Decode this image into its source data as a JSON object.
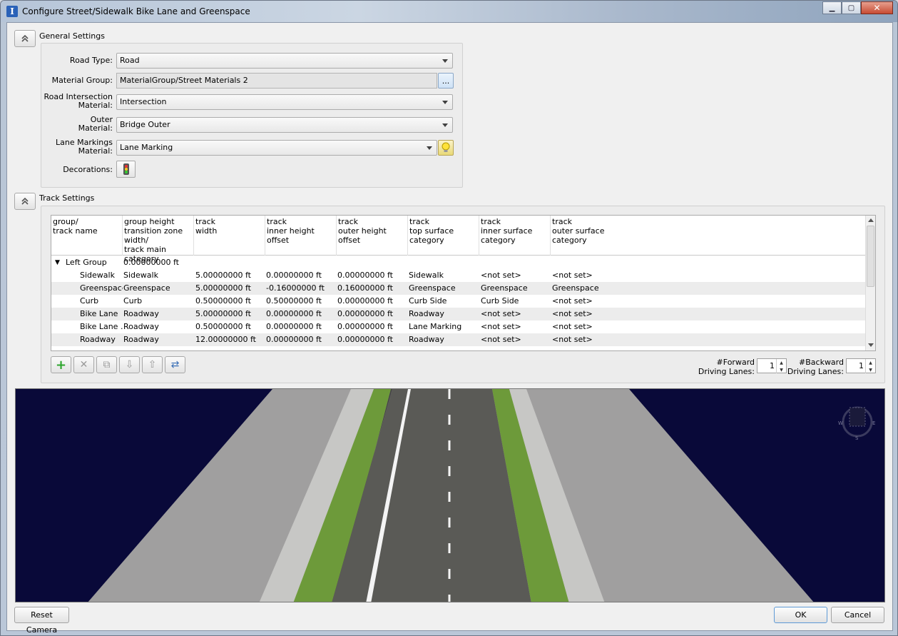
{
  "window": {
    "title": "Configure Street/Sidewalk Bike Lane and Greenspace",
    "minimize_glyph": "▁",
    "maximize_glyph": "▢",
    "close_glyph": "✕"
  },
  "general_settings": {
    "title": "General Settings",
    "road_type": {
      "label": "Road Type:",
      "value": "Road"
    },
    "material_group": {
      "label": "Material Group:",
      "value": "MaterialGroup/Street Materials 2",
      "browse_label": "..."
    },
    "road_intersection_material": {
      "label": "Road Intersection\nMaterial:",
      "value": "Intersection"
    },
    "outer_material": {
      "label": "Outer\nMaterial:",
      "value": "Bridge Outer"
    },
    "lane_markings_material": {
      "label": "Lane Markings\nMaterial:",
      "value": "Lane Marking"
    },
    "decorations": {
      "label": "Decorations:"
    }
  },
  "track_settings": {
    "title": "Track Settings",
    "columns": [
      "group/\ntrack name",
      "group height\ntransition zone\nwidth/\ntrack main category",
      "track\nwidth",
      "track\ninner height\noffset",
      "track\nouter height\noffset",
      "track\ntop surface\ncategory",
      "track\ninner surface\ncategory",
      "track\nouter surface\ncategory"
    ],
    "group": {
      "expander": "▼",
      "name": "Left Group",
      "height": "0.00000000 ft"
    },
    "rows": [
      [
        "Sidewalk",
        "Sidewalk",
        "5.00000000 ft",
        "0.00000000 ft",
        "0.00000000 ft",
        "Sidewalk",
        "<not set>",
        "<not set>"
      ],
      [
        "Greenspace",
        "Greenspace",
        "5.00000000 ft",
        "-0.16000000 ft",
        "0.16000000 ft",
        "Greenspace",
        "Greenspace",
        "Greenspace"
      ],
      [
        "Curb",
        "Curb",
        "0.50000000 ft",
        "0.50000000 ft",
        "0.00000000 ft",
        "Curb Side",
        "Curb Side",
        "<not set>"
      ],
      [
        "Bike Lane",
        "Roadway",
        "5.00000000 ft",
        "0.00000000 ft",
        "0.00000000 ft",
        "Roadway",
        "<not set>",
        "<not set>"
      ],
      [
        "Bike Lane ...",
        "Roadway",
        "0.50000000 ft",
        "0.00000000 ft",
        "0.00000000 ft",
        "Lane Marking",
        "<not set>",
        "<not set>"
      ],
      [
        "Roadway",
        "Roadway",
        "12.00000000 ft",
        "0.00000000 ft",
        "0.00000000 ft",
        "Roadway",
        "<not set>",
        "<not set>"
      ]
    ],
    "forward_lanes": {
      "label": "#Forward\nDriving Lanes:",
      "value": "1"
    },
    "backward_lanes": {
      "label": "#Backward\nDriving Lanes:",
      "value": "1"
    },
    "tools": {
      "add": "+",
      "delete": "✕",
      "copy": "⧉",
      "down": "⇩",
      "up": "⇧",
      "swap": "⇄"
    }
  },
  "compass": {
    "w": "W",
    "e": "E",
    "s": "S"
  },
  "buttons": {
    "reset_camera": "Reset Camera",
    "ok": "OK",
    "cancel": "Cancel"
  },
  "colors": {
    "sky": "#090939",
    "road": "#5a5a56",
    "grass": "#6d9a3a",
    "sidewalk": "#a09f9f",
    "stone": "#c7c7c5"
  }
}
